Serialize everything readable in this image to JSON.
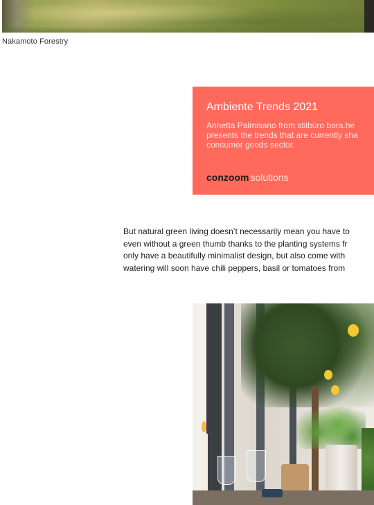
{
  "top_image": {
    "caption": "Nakamoto Forestry"
  },
  "promo": {
    "title": "Ambiente Trends 2021",
    "text_lines": [
      "Annetta Palmisano from stilbüro bora.he",
      "presents the trends that are currently sha",
      "consumer goods sector."
    ],
    "brand_bold": "conzoom",
    "brand_light": "solutions",
    "background_color": "#ff6a5c"
  },
  "article": {
    "paragraph_lines": [
      "But natural green living doesn’t necessarily mean you have to",
      "even without a green thumb thanks to the planting systems fr",
      "only have a beautifully minimalist design, but also come with",
      "watering will soon have chili peppers, basil or tomatoes from"
    ]
  }
}
